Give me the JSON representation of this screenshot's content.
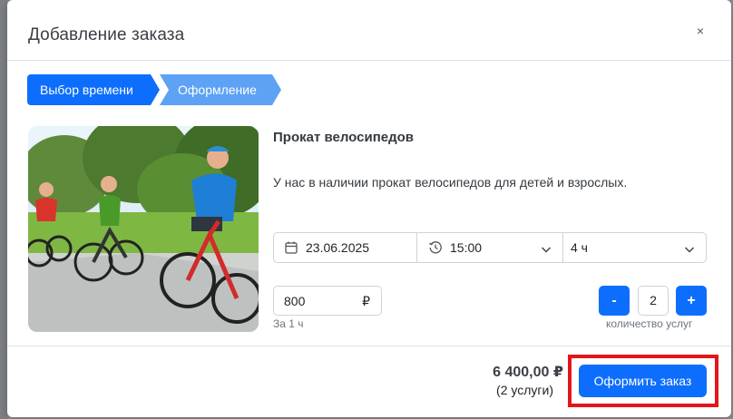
{
  "modal": {
    "title": "Добавление заказа",
    "close_label": "×"
  },
  "steps": [
    {
      "label": "Выбор времени"
    },
    {
      "label": "Оформление"
    }
  ],
  "product": {
    "title": "Прокат велосипедов",
    "description": "У нас в наличии прокат велосипедов для детей и взрослых."
  },
  "booking": {
    "date": "23.06.2025",
    "time": "15:00",
    "duration": "4 ч"
  },
  "price": {
    "value": "800",
    "currency": "₽",
    "per_label": "За 1 ч"
  },
  "quantity": {
    "minus_label": "-",
    "value": "2",
    "plus_label": "+",
    "caption": "количество услуг"
  },
  "footer": {
    "total": "6 400,00 ₽",
    "services_count": "(2 услуги)",
    "order_button_label": "Оформить заказ"
  },
  "colors": {
    "primary": "#0d6efd",
    "step_secondary": "#5da2f5",
    "highlight": "#e3151b"
  }
}
